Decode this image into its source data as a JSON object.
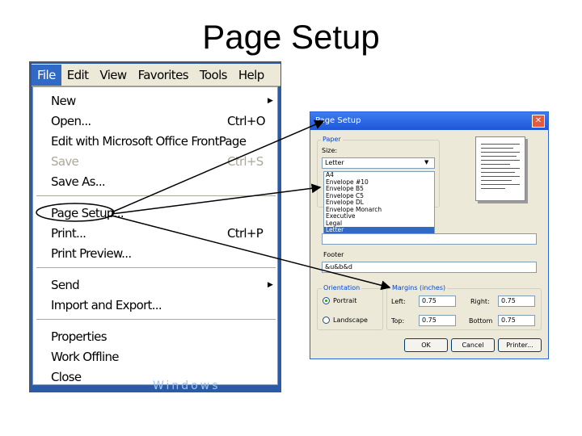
{
  "slide": {
    "title": "Page Setup"
  },
  "menubar": {
    "items": [
      "File",
      "Edit",
      "View",
      "Favorites",
      "Tools",
      "Help"
    ]
  },
  "file_menu": {
    "new": "New",
    "open": "Open...",
    "open_shortcut": "Ctrl+O",
    "edit_frontpage": "Edit with Microsoft Office FrontPage",
    "save": "Save",
    "save_shortcut": "Ctrl+S",
    "save_as": "Save As...",
    "page_setup": "Page Setup...",
    "print": "Print...",
    "print_shortcut": "Ctrl+P",
    "print_preview": "Print Preview...",
    "send": "Send",
    "import_export": "Import and Export...",
    "properties": "Properties",
    "work_offline": "Work Offline",
    "close": "Close"
  },
  "background_text": "Windows",
  "dialog": {
    "title": "Page Setup",
    "paper_group": "Paper",
    "size_label": "Size:",
    "size_value": "Letter",
    "size_options": [
      "A4",
      "Envelope #10",
      "Envelope B5",
      "Envelope C5",
      "Envelope DL",
      "Envelope Monarch",
      "Executive",
      "Legal",
      "Letter"
    ],
    "footer_label": "Footer",
    "footer_value": "&u&b&d",
    "orientation_group": "Orientation",
    "portrait": "Portrait",
    "landscape": "Landscape",
    "margins_group": "Margins (inches)",
    "left_label": "Left:",
    "left_value": "0.75",
    "right_label": "Right:",
    "right_value": "0.75",
    "top_label": "Top:",
    "top_value": "0.75",
    "bottom_label": "Bottom",
    "bottom_value": "0.75",
    "ok": "OK",
    "cancel": "Cancel",
    "printer": "Printer..."
  },
  "colors": {
    "selection": "#316ac5",
    "titlebar": "#1f56d8",
    "dialog_bg": "#ece9d8"
  }
}
